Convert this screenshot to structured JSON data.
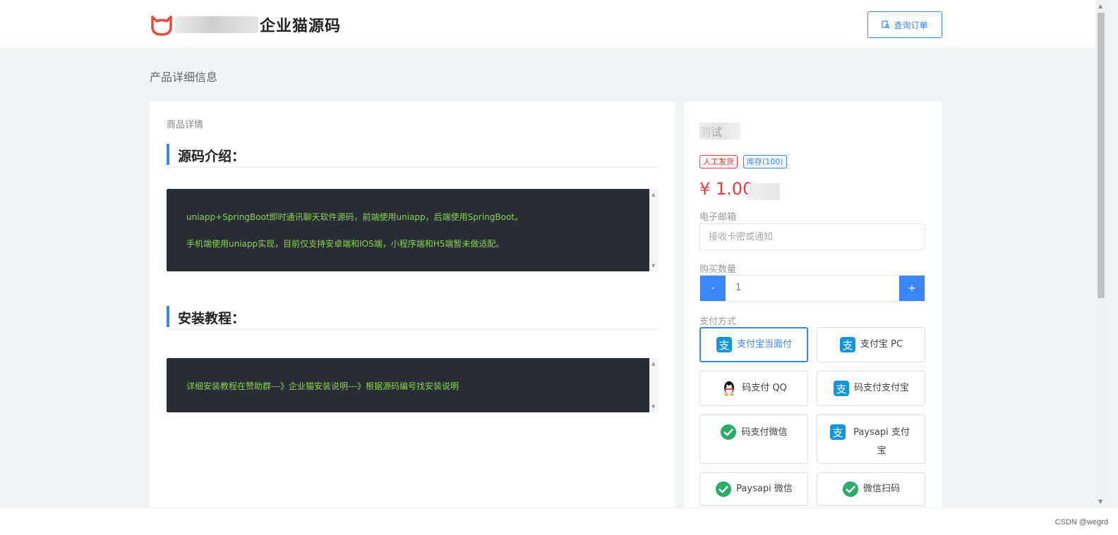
{
  "header": {
    "logo_text": "企业猫源码",
    "query_order_label": "查询订单"
  },
  "page_title": "产品详细信息",
  "detail": {
    "card_label": "商品详情",
    "intro_heading": "源码介绍：",
    "intro_lines": [
      "uniapp+SpringBoot即时通讯聊天软件源码，前端使用uniapp，后端使用SpringBoot。",
      "手机端使用uniapp实现，目前仅支持安卓端和IOS端，小程序端和H5端暂未做适配。"
    ],
    "install_heading": "安装教程：",
    "install_lines": [
      "详细安装教程在赞助群---》企业猫安装说明---》根据源码编号找安装说明"
    ]
  },
  "product": {
    "name": "测试",
    "tags": [
      "人工发货",
      "库存(100)"
    ],
    "price": "¥ 1.00",
    "email_label": "电子邮箱",
    "email_placeholder": "接收卡密或通知",
    "qty_label": "购买数量",
    "qty_value": "1",
    "minus_label": "-",
    "plus_label": "+",
    "payment_label": "支付方式",
    "payments": [
      {
        "label": "支付宝当面付",
        "icon": "alipay-icon"
      },
      {
        "label": "支付宝 PC",
        "icon": "alipay-icon"
      },
      {
        "label": "码支付 QQ",
        "icon": "qq-icon"
      },
      {
        "label": "码支付支付宝",
        "icon": "alipay-icon"
      },
      {
        "label": "码支付微信",
        "icon": "wechat-icon"
      },
      {
        "label": "Paysapi 支付宝",
        "icon": "alipay-icon"
      },
      {
        "label": "Paysapi 微信",
        "icon": "wechat-icon"
      },
      {
        "label": "微信扫码",
        "icon": "wechat-icon"
      }
    ]
  },
  "watermark": "CSDN @wegrd",
  "colors": {
    "accent": "#3a86f6",
    "price": "#ef3b3b",
    "code_bg": "#282c34",
    "code_text": "#8bd34f"
  }
}
